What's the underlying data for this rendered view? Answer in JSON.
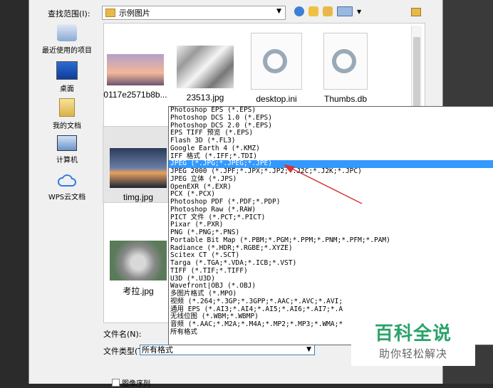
{
  "lookin": {
    "label": "查找范围(I):",
    "value": "示例图片"
  },
  "places": [
    {
      "label": "最近使用的项目",
      "icon": "recent-items-icon"
    },
    {
      "label": "桌面",
      "icon": "desktop-icon"
    },
    {
      "label": "我的文档",
      "icon": "documents-icon"
    },
    {
      "label": "计算机",
      "icon": "computer-icon"
    },
    {
      "label": "WPS云文档",
      "icon": "cloud-icon"
    }
  ],
  "files": [
    {
      "name": "0117e2571b8b..."
    },
    {
      "name": "23513.jpg"
    },
    {
      "name": "desktop.ini"
    },
    {
      "name": "Thumbs.db"
    },
    {
      "name": "timg.jpg"
    },
    {
      "name": "考拉.jpg"
    }
  ],
  "filename": {
    "label": "文件名(N):"
  },
  "filetype": {
    "label": "文件类型(T):",
    "value": "所有格式"
  },
  "preview_label": "图像序列",
  "filetype_options": [
    "Photoshop EPS (*.EPS)",
    "Photoshop DCS 1.0 (*.EPS)",
    "Photoshop DCS 2.0 (*.EPS)",
    "EPS TIFF 预览 (*.EPS)",
    "Flash 3D (*.FL3)",
    "Google Earth 4 (*.KMZ)",
    "IFF 格式 (*.IFF;*.TDI)",
    "JPEG (*.JPG;*.JPEG;*.JPE)",
    "JPEG 2000 (*.JPF;*.JPX;*.JP2;*.J2C;*.J2K;*.JPC)",
    "JPEG 立体 (*.JPS)",
    "OpenEXR (*.EXR)",
    "PCX (*.PCX)",
    "Photoshop PDF (*.PDF;*.PDP)",
    "Photoshop Raw (*.RAW)",
    "PICT 文件 (*.PCT;*.PICT)",
    "Pixar (*.PXR)",
    "PNG (*.PNG;*.PNS)",
    "Portable Bit Map (*.PBM;*.PGM;*.PPM;*.PNM;*.PFM;*.PAM)",
    "Radiance (*.HDR;*.RGBE;*.XYZE)",
    "Scitex CT (*.SCT)",
    "Targa (*.TGA;*.VDA;*.ICB;*.VST)",
    "TIFF (*.TIF;*.TIFF)",
    "U3D (*.U3D)",
    "Wavefront|OBJ (*.OBJ)",
    "多图片格式 (*.MPO)",
    "视频 (*.264;*.3GP;*.3GPP;*.AAC;*.AVC;*.AVI;",
    "通用 EPS (*.AI3;*.AI4;*.AI5;*.AI6;*.AI7;*.A",
    "无线位图 (*.WBM;*.WBMP)",
    "音频 (*.AAC;*.M2A;*.M4A;*.MP2;*.MP3;*.WMA;*",
    "所有格式"
  ],
  "selected_option_index": 7,
  "watermark": {
    "title": "百科全说",
    "subtitle": "助你轻松解决"
  },
  "colors": {
    "selection": "#3399ff",
    "arrow": "#d93434",
    "watermark": "#2aa36a"
  }
}
